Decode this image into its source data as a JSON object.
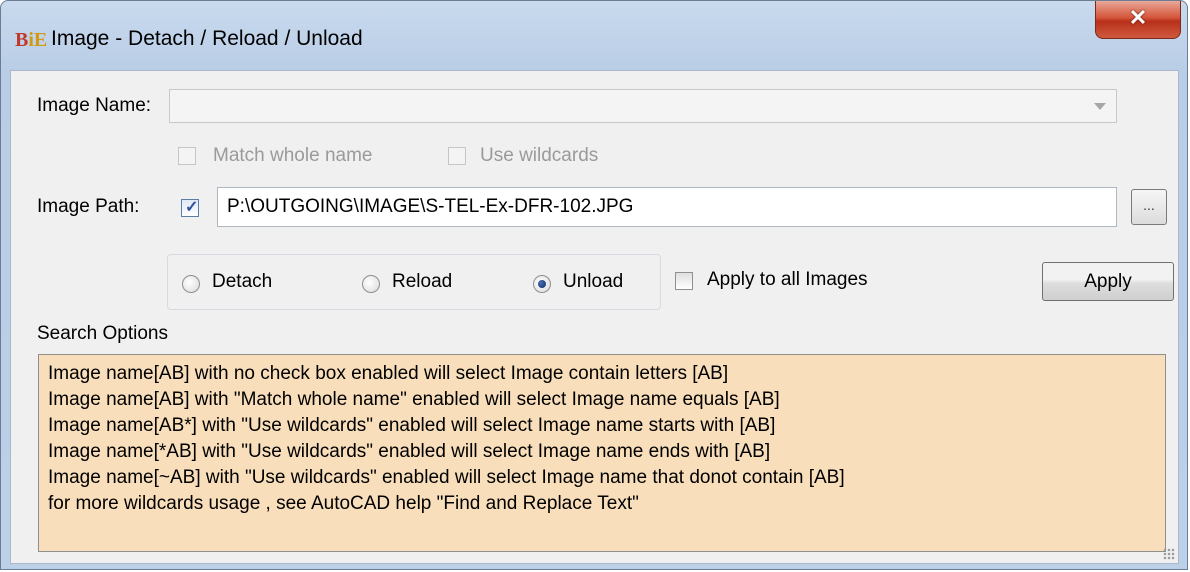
{
  "window": {
    "app_icon_text": "BiE",
    "title": "Image - Detach / Reload / Unload",
    "close_glyph": "✕"
  },
  "form": {
    "image_name_label": "Image Name:",
    "image_name_value": "",
    "match_whole_name_label": "Match whole name",
    "match_whole_name_checked": false,
    "use_wildcards_label": "Use wildcards",
    "use_wildcards_checked": false,
    "image_path_label": "Image  Path:",
    "image_path_checked": true,
    "image_path_value": "P:\\OUTGOING\\IMAGE\\S-TEL-Ex-DFR-102.JPG",
    "browse_label": "...",
    "actions": [
      {
        "label": "Detach",
        "selected": false
      },
      {
        "label": "Reload",
        "selected": false
      },
      {
        "label": "Unload",
        "selected": true
      }
    ],
    "apply_all_label": "Apply to all Images",
    "apply_all_checked": false,
    "apply_button": "Apply"
  },
  "search_options": {
    "title": "Search Options",
    "lines": [
      "Image name[AB] with no check box enabled will select Image contain letters [AB]",
      "Image name[AB] with \"Match whole name\" enabled will select Image name equals [AB]",
      "Image name[AB*] with \"Use wildcards\" enabled will select Image name starts with [AB]",
      "Image name[*AB] with \"Use wildcards\" enabled will select Image name ends with [AB]",
      "Image name[~AB] with \"Use wildcards\" enabled will select Image name that donot contain [AB]",
      "for more wildcards usage , see AutoCAD help  \"Find and Replace Text\""
    ]
  }
}
